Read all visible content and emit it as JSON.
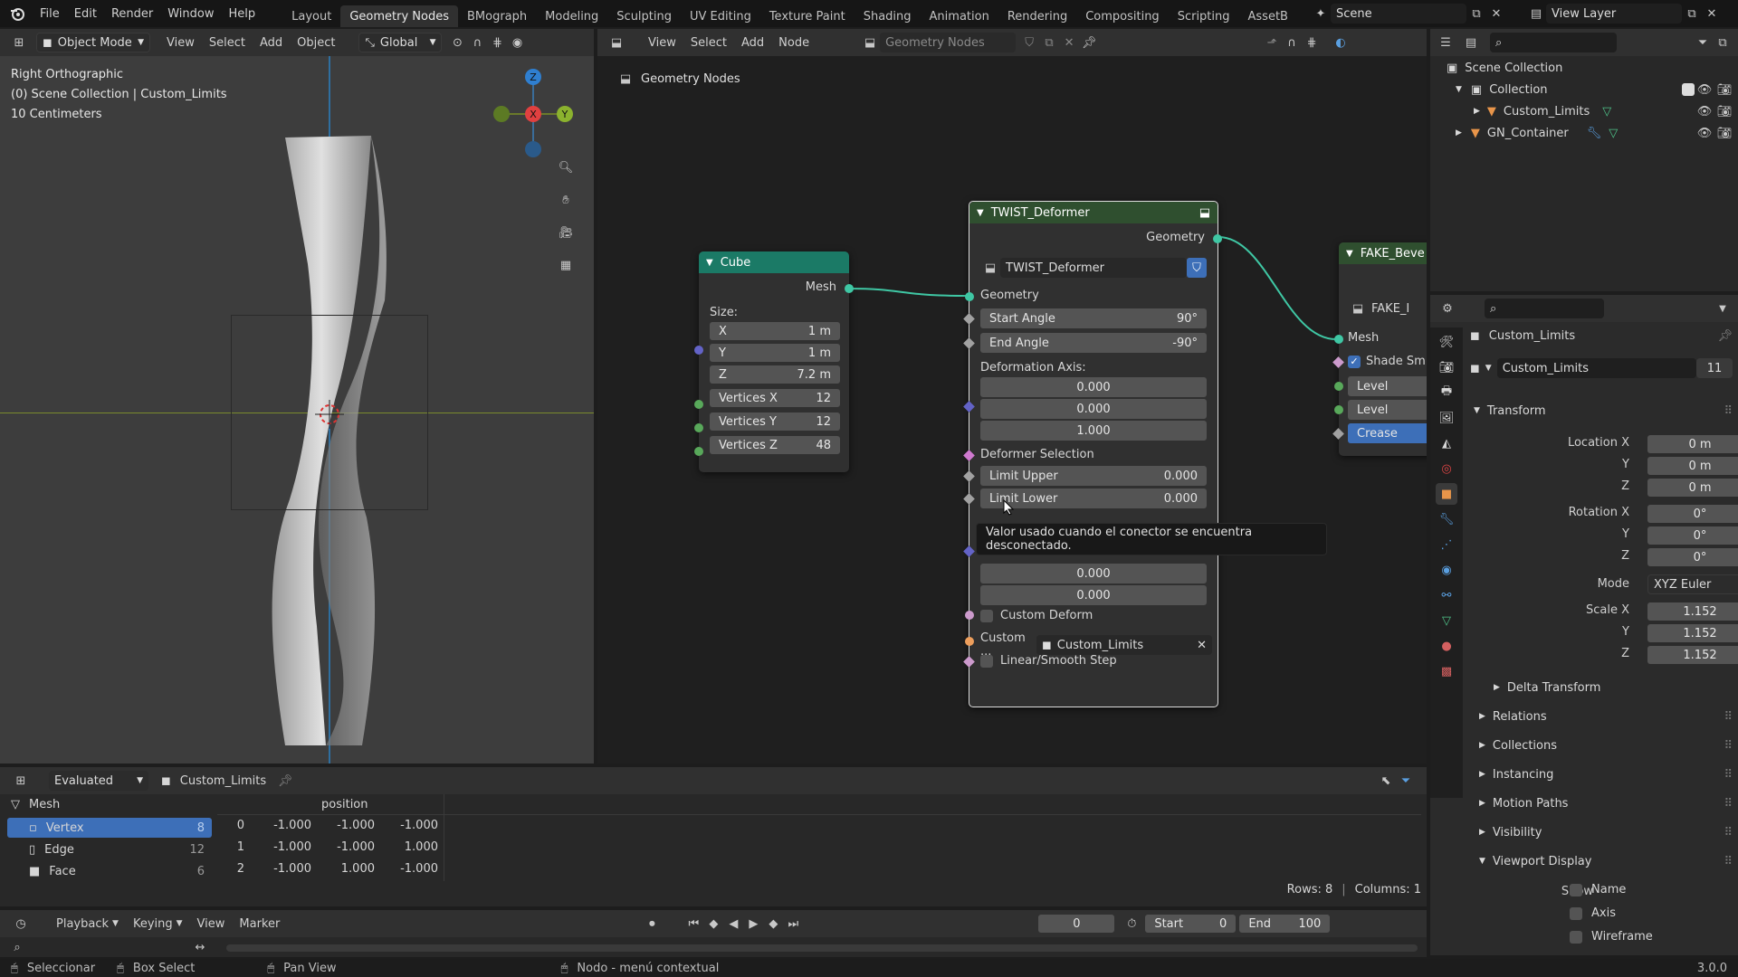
{
  "topbar": {
    "menus": [
      "File",
      "Edit",
      "Render",
      "Window",
      "Help"
    ],
    "workspaces": [
      "Layout",
      "Geometry Nodes",
      "BMograph",
      "Modeling",
      "Sculpting",
      "UV Editing",
      "Texture Paint",
      "Shading",
      "Animation",
      "Rendering",
      "Compositing",
      "Scripting",
      "AssetB"
    ],
    "active_workspace": "Geometry Nodes",
    "scene": "Scene",
    "view_layer": "View Layer"
  },
  "viewport": {
    "mode": "Object Mode",
    "menus": [
      "View",
      "Select",
      "Add",
      "Object"
    ],
    "transform_orientation": "Global",
    "overlay_lines": [
      "Right Orthographic",
      "(0) Scene Collection | Custom_Limits",
      "10 Centimeters"
    ],
    "gizmo": {
      "z": "Z",
      "x": "X",
      "y": "Y"
    }
  },
  "node_editor": {
    "menus": [
      "View",
      "Select",
      "Add",
      "Node"
    ],
    "tree_name": "Geometry Nodes",
    "breadcrumb": "Geometry Nodes",
    "cube_node": {
      "title": "Cube",
      "output": "Mesh",
      "size_label": "Size:",
      "fields": [
        {
          "label": "X",
          "value": "1 m"
        },
        {
          "label": "Y",
          "value": "1 m"
        },
        {
          "label": "Z",
          "value": "7.2 m"
        },
        {
          "label": "Vertices X",
          "value": "12"
        },
        {
          "label": "Vertices Y",
          "value": "12"
        },
        {
          "label": "Vertices Z",
          "value": "48"
        }
      ]
    },
    "twist_node": {
      "title": "TWIST_Deformer",
      "output": "Geometry",
      "group_name": "TWIST_Deformer",
      "input_geometry": "Geometry",
      "start_angle_label": "Start Angle",
      "start_angle": "90°",
      "end_angle_label": "End Angle",
      "end_angle": "-90°",
      "axis_label": "Deformation Axis:",
      "axis": [
        "0.000",
        "0.000",
        "1.000"
      ],
      "selection_label": "Deformer Selection",
      "limit_upper_label": "Limit Upper",
      "limit_upper": "0.000",
      "limit_lower_label": "Limit Lower",
      "limit_lower": "0.000",
      "center_values": [
        "0.000",
        "0.000"
      ],
      "custom_deform": "Custom Deform",
      "custom_obj_label": "Custom ...",
      "custom_obj": "Custom_Limits",
      "linear_smooth": "Linear/Smooth Step"
    },
    "fake_node": {
      "title": "FAKE_Beve",
      "group_name": "FAKE_I",
      "input": "Mesh",
      "shade": "Shade Sm",
      "level1": "Level",
      "level2": "Level",
      "crease": "Crease"
    },
    "tooltip": "Valor usado cuando el conector se encuentra desconectado."
  },
  "outliner": {
    "root": "Scene Collection",
    "collection": "Collection",
    "items": [
      "Custom_Limits",
      "GN_Container"
    ]
  },
  "properties": {
    "object_name": "Custom_Limits",
    "datablock": "Custom_Limits",
    "users": "11",
    "transform": "Transform",
    "location_label": "Location X",
    "location": [
      "0 m",
      "0 m",
      "0 m"
    ],
    "rotation_label": "Rotation X",
    "rotation": [
      "0°",
      "0°",
      "0°"
    ],
    "mode_label": "Mode",
    "mode": "XYZ Euler",
    "scale_label": "Scale X",
    "scale": [
      "1.152",
      "1.152",
      "1.152"
    ],
    "axis_y": "Y",
    "axis_z": "Z",
    "panels": [
      "Delta Transform",
      "Relations",
      "Collections",
      "Instancing",
      "Motion Paths",
      "Visibility",
      "Viewport Display"
    ],
    "show_label": "Show",
    "show_items": [
      "Name",
      "Axis",
      "Wireframe"
    ]
  },
  "spreadsheet": {
    "mode": "Evaluated",
    "object": "Custom_Limits",
    "domain_root": "Mesh",
    "domains": [
      {
        "name": "Vertex",
        "count": "8"
      },
      {
        "name": "Edge",
        "count": "12"
      },
      {
        "name": "Face",
        "count": "6"
      }
    ],
    "column": "position",
    "rows": [
      {
        "i": "0",
        "v": [
          "-1.000",
          "-1.000",
          "-1.000"
        ]
      },
      {
        "i": "1",
        "v": [
          "-1.000",
          "-1.000",
          "1.000"
        ]
      },
      {
        "i": "2",
        "v": [
          "-1.000",
          "1.000",
          "-1.000"
        ]
      }
    ],
    "rows_count": "Rows: 8",
    "columns_count": "Columns: 1"
  },
  "timeline": {
    "menus": [
      "Playback",
      "Keying",
      "View",
      "Marker"
    ],
    "frame": "0",
    "start_label": "Start",
    "start": "0",
    "end_label": "End",
    "end": "100"
  },
  "statusbar": {
    "items": [
      "Seleccionar",
      "Box Select",
      "Pan View",
      "Nodo - menú contextual"
    ],
    "version": "3.0.0"
  }
}
